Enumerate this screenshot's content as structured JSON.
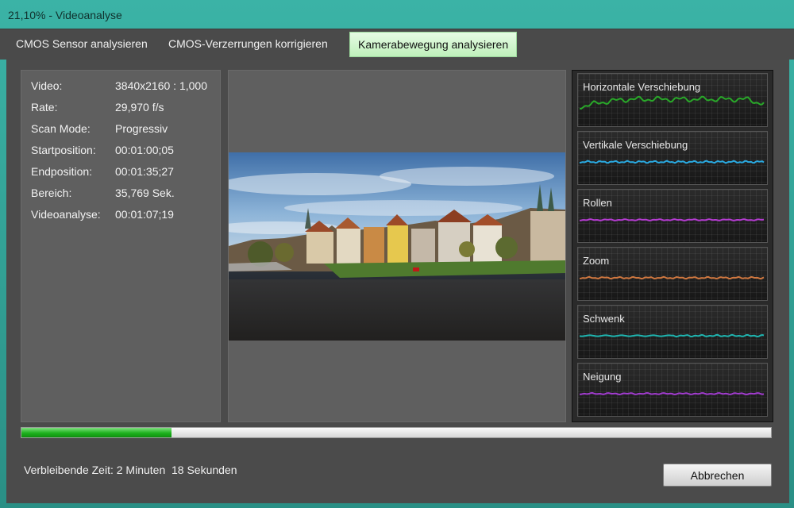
{
  "window": {
    "title": "21,10% - Videoanalyse"
  },
  "tabs": [
    {
      "label": "CMOS Sensor analysieren",
      "active": false
    },
    {
      "label": "CMOS-Verzerrungen korrigieren",
      "active": false
    },
    {
      "label": "Kamerabewegung analysieren",
      "active": true
    }
  ],
  "info": {
    "rows": [
      {
        "label": "Video:",
        "value": "3840x2160 : 1,000"
      },
      {
        "label": "Rate:",
        "value": "29,970 f/s"
      },
      {
        "label": "Scan Mode:",
        "value": "Progressiv"
      },
      {
        "label": "Startposition:",
        "value": "00:01:00;05"
      },
      {
        "label": "Endposition:",
        "value": "00:01:35;27"
      },
      {
        "label": "Bereich:",
        "value": "35,769 Sek."
      },
      {
        "label": "Videoanalyse:",
        "value": "00:01:07;19"
      }
    ]
  },
  "graphs": [
    {
      "name": "Horizontale Verschiebung",
      "color": "#29a829"
    },
    {
      "name": "Vertikale Verschiebung",
      "color": "#2aa9e0"
    },
    {
      "name": "Rollen",
      "color": "#b43cd0"
    },
    {
      "name": "Zoom",
      "color": "#d07840"
    },
    {
      "name": "Schwenk",
      "color": "#1fb5b0"
    },
    {
      "name": "Neigung",
      "color": "#a23cd0"
    }
  ],
  "progress": {
    "fraction": 0.2
  },
  "status": {
    "remaining": "Verbleibende Zeit: 2 Minuten  18 Sekunden"
  },
  "buttons": {
    "cancel": "Abbrechen"
  }
}
